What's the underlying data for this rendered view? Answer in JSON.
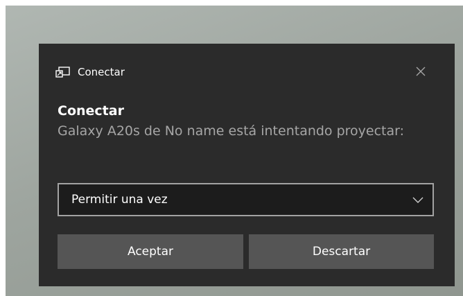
{
  "notification": {
    "app_icon": "project-screen-icon",
    "app_name": "Conectar",
    "close_icon": "close-icon",
    "title": "Conectar",
    "message": "Galaxy A20s de No name está intentando proyectar:",
    "select": {
      "selected_value": "Permitir una vez",
      "chevron_icon": "chevron-down-icon"
    },
    "buttons": {
      "accept_label": "Aceptar",
      "dismiss_label": "Descartar"
    }
  },
  "colors": {
    "toast_background": "#2b2b2b",
    "button_background": "#555555",
    "select_background": "#1c1c1c",
    "select_border": "#a3a3a3",
    "secondary_text": "#a6a6a6"
  }
}
